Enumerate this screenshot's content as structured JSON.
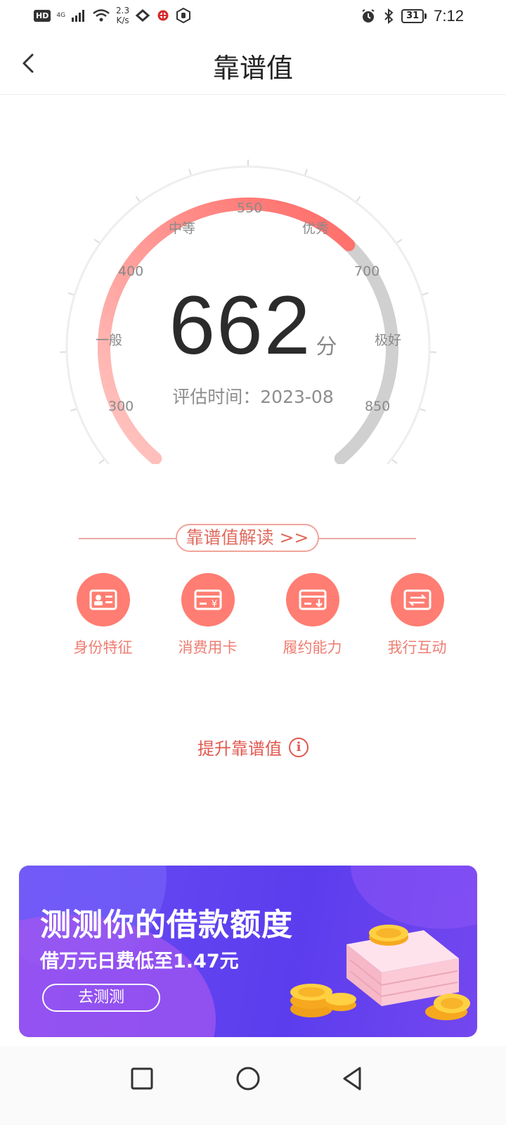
{
  "status_bar": {
    "hd": "HD",
    "network": "4G",
    "speed_value": "2.3",
    "speed_unit": "K/s",
    "battery": "31",
    "time": "7:12",
    "icons": [
      "signal-icon",
      "wifi-icon",
      "heart-app-icon",
      "unicom-icon",
      "hand-icon",
      "alarm-icon",
      "bluetooth-icon",
      "battery-icon"
    ]
  },
  "header": {
    "title": "靠谱值",
    "back_icon": "chevron-left-icon"
  },
  "gauge": {
    "score": "662",
    "unit": "分",
    "eval_time": "评估时间：2023-08",
    "min": 300,
    "max": 850,
    "value": 662,
    "ticks": [
      "300",
      "400",
      "550",
      "700",
      "850"
    ],
    "levels": [
      "一般",
      "中等",
      "优秀",
      "极好"
    ],
    "colors": {
      "progress_start": "#ffc3bf",
      "progress_end": "#ff6b66",
      "remaining": "#d0d0d0",
      "outer_ring": "#eeeeee"
    }
  },
  "interpretation": {
    "button_label": "靠谱值解读 >>",
    "categories": [
      {
        "label": "身份特征",
        "icon": "id-card-icon"
      },
      {
        "label": "消费用卡",
        "icon": "card-yen-icon"
      },
      {
        "label": "履约能力",
        "icon": "bill-download-icon"
      },
      {
        "label": "我行互动",
        "icon": "transfer-icon"
      }
    ]
  },
  "improve": {
    "label": "提升靠谱值",
    "info_glyph": "i"
  },
  "banner": {
    "headline": "测测你的借款额度",
    "subline": "借万元日费低至1.47元",
    "button_label": "去测测"
  },
  "nav": {
    "icons": [
      "recent-apps-icon",
      "home-icon",
      "back-icon"
    ]
  }
}
